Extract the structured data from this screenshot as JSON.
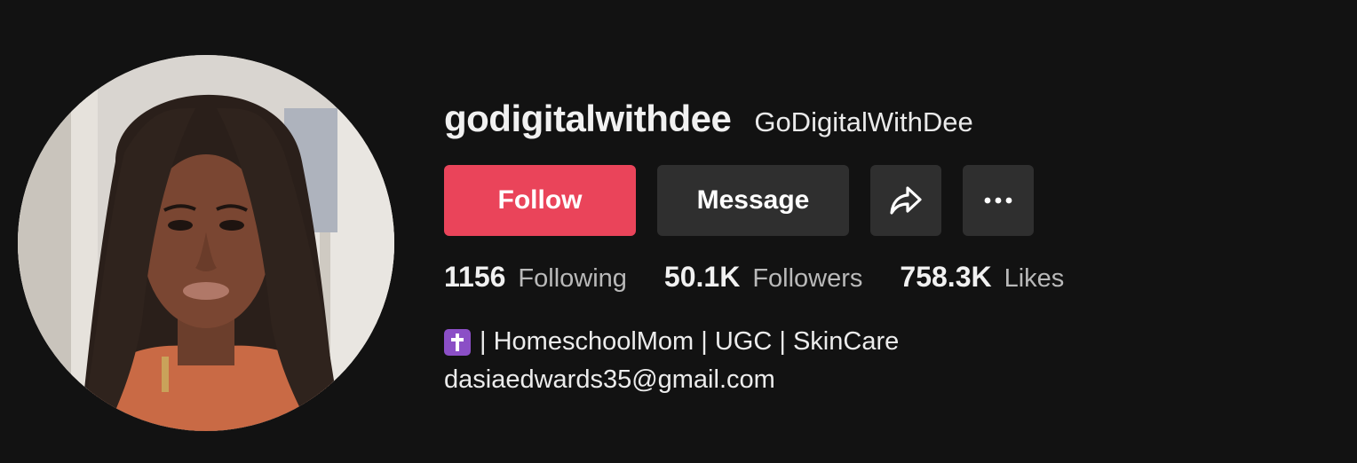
{
  "profile": {
    "username": "godigitalwithdee",
    "nickname": "GoDigitalWithDee",
    "avatar_icon": "profile-photo",
    "follow_button": {
      "label": "Follow",
      "color": "#ea445a"
    },
    "message_button": {
      "label": "Message"
    },
    "share_button": {
      "icon": "share-arrow-icon"
    },
    "more_button": {
      "icon": "more-horizontal-icon"
    },
    "stats": [
      {
        "value": "1156",
        "label": "Following"
      },
      {
        "value": "50.1K",
        "label": "Followers"
      },
      {
        "value": "758.3K",
        "label": "Likes"
      }
    ],
    "bio": {
      "emoji": "latin-cross-emoji",
      "line1": "| HomeschoolMom | UGC | SkinCare",
      "line2": "dasiaedwards35@gmail.com"
    }
  },
  "colors": {
    "background": "#121212",
    "button_secondary": "#2f2f2f",
    "accent": "#ea445a"
  }
}
